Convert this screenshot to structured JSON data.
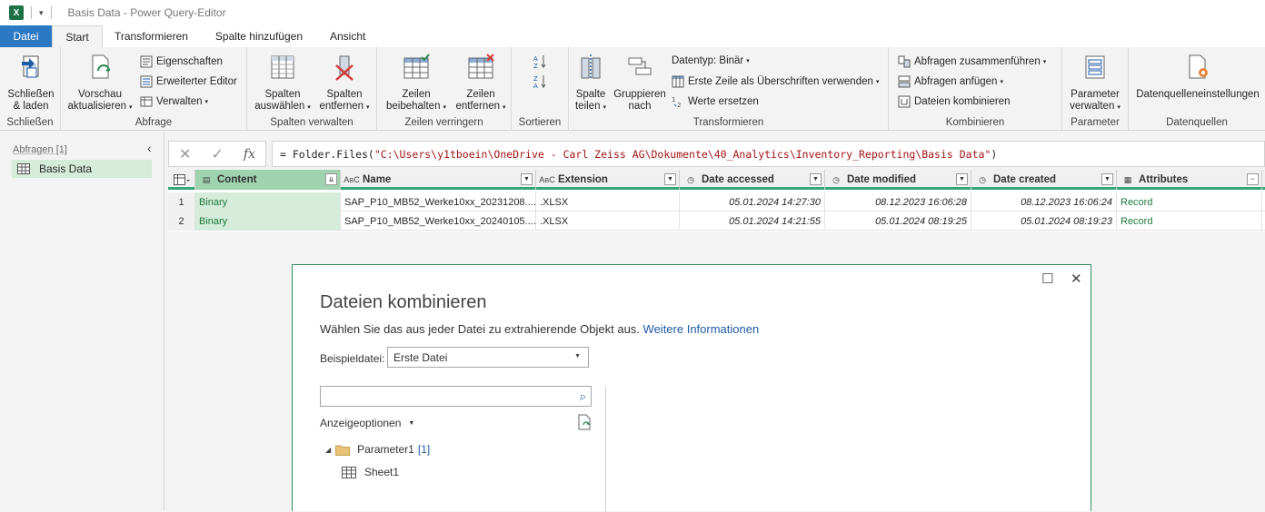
{
  "titlebar": {
    "title": "Basis Data - Power Query-Editor",
    "logo": "X"
  },
  "tabs": [
    {
      "label": "Datei"
    },
    {
      "label": "Start"
    },
    {
      "label": "Transformieren"
    },
    {
      "label": "Spalte hinzufügen"
    },
    {
      "label": "Ansicht"
    }
  ],
  "ribbon": {
    "close_group": {
      "label": "Schließen",
      "close_load": "Schließen\n& laden"
    },
    "query_group": {
      "label": "Abfrage",
      "refresh": "Vorschau\naktualisieren",
      "properties": "Eigenschaften",
      "advanced_editor": "Erweiterter Editor",
      "manage": "Verwalten"
    },
    "columns_group": {
      "label": "Spalten verwalten",
      "choose": "Spalten\nauswählen",
      "remove": "Spalten\nentfernen"
    },
    "rows_group": {
      "label": "Zeilen verringern",
      "keep": "Zeilen\nbeibehalten",
      "remove": "Zeilen\nentfernen"
    },
    "sort_group": {
      "label": "Sortieren"
    },
    "transform_group": {
      "label": "Transformieren",
      "split": "Spalte\nteilen",
      "group_by": "Gruppieren\nnach",
      "datatype": "Datentyp: Binär",
      "first_row": "Erste Zeile als Überschriften verwenden",
      "replace": "Werte ersetzen"
    },
    "combine_group": {
      "label": "Kombinieren",
      "merge": "Abfragen zusammenführen",
      "append": "Abfragen anfügen",
      "combine_files": "Dateien kombinieren"
    },
    "param_group": {
      "label": "Parameter",
      "manage": "Parameter\nverwalten"
    },
    "source_group": {
      "label": "Datenquellen",
      "settings": "Datenquelleneinstellungen"
    }
  },
  "queries": {
    "header": "Abfragen [1]",
    "items": [
      {
        "label": "Basis Data"
      }
    ]
  },
  "formula": {
    "prefix": "= Folder.Files(",
    "string": "\"C:\\Users\\y1tboein\\OneDrive - Carl Zeiss AG\\Dokumente\\40_Analytics\\Inventory_Reporting\\Basis Data\"",
    "suffix": ")"
  },
  "grid": {
    "columns": [
      {
        "name": "Content",
        "type_icon": "binary"
      },
      {
        "name": "Name",
        "type_icon": "text"
      },
      {
        "name": "Extension",
        "type_icon": "text"
      },
      {
        "name": "Date accessed",
        "type_icon": "datetime"
      },
      {
        "name": "Date modified",
        "type_icon": "datetime"
      },
      {
        "name": "Date created",
        "type_icon": "datetime"
      },
      {
        "name": "Attributes",
        "type_icon": "table"
      }
    ],
    "rows": [
      {
        "num": "1",
        "content": "Binary",
        "name": "SAP_P10_MB52_Werke10xx_20231208....",
        "extension": ".XLSX",
        "accessed": "05.01.2024 14:27:30",
        "modified": "08.12.2023 16:06:28",
        "created": "08.12.2023 16:06:24",
        "attributes": "Record"
      },
      {
        "num": "2",
        "content": "Binary",
        "name": "SAP_P10_MB52_Werke10xx_20240105....",
        "extension": ".XLSX",
        "accessed": "05.01.2024 14:21:55",
        "modified": "05.01.2024 08:19:25",
        "created": "05.01.2024 08:19:23",
        "attributes": "Record"
      }
    ]
  },
  "dialog": {
    "title": "Dateien kombinieren",
    "description": "Wählen Sie das aus jeder Datei zu extrahierende Objekt aus.",
    "link": "Weitere Informationen",
    "sample_label": "Beispieldatei:",
    "sample_value": "Erste Datei",
    "search_placeholder": "",
    "display_options": "Anzeigeoptionen",
    "tree": {
      "folder": "Parameter1",
      "folder_count": "[1]",
      "sheet": "Sheet1"
    }
  }
}
